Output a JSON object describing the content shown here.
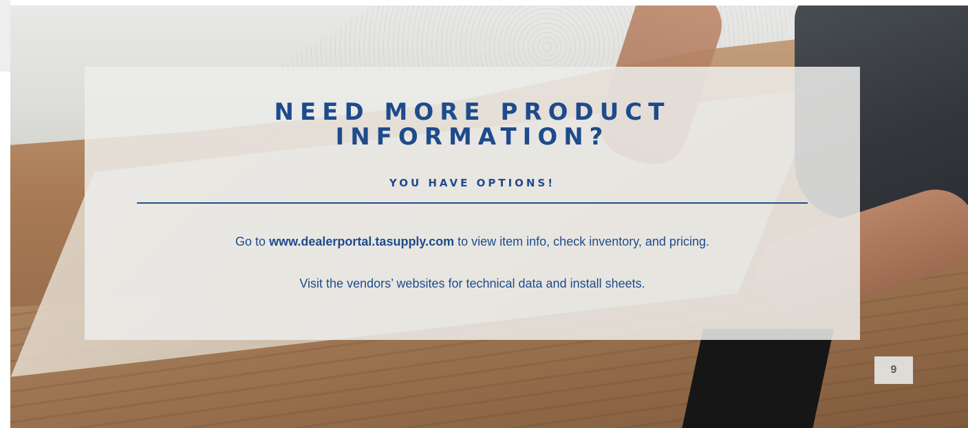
{
  "slide": {
    "title_line1": "NEED MORE PRODUCT",
    "title_line2": "INFORMATION?",
    "subtitle": "YOU HAVE OPTIONS!",
    "line1_prefix": "Go to ",
    "line1_link": "www.dealerportal.tasupply.com",
    "line1_suffix": " to view item info, check inventory, and pricing.",
    "line2": "Visit the vendors’ websites for technical data and install sheets.",
    "page_number": "9"
  },
  "colors": {
    "accent": "#1e4b8c",
    "panel": "#ecece9"
  }
}
